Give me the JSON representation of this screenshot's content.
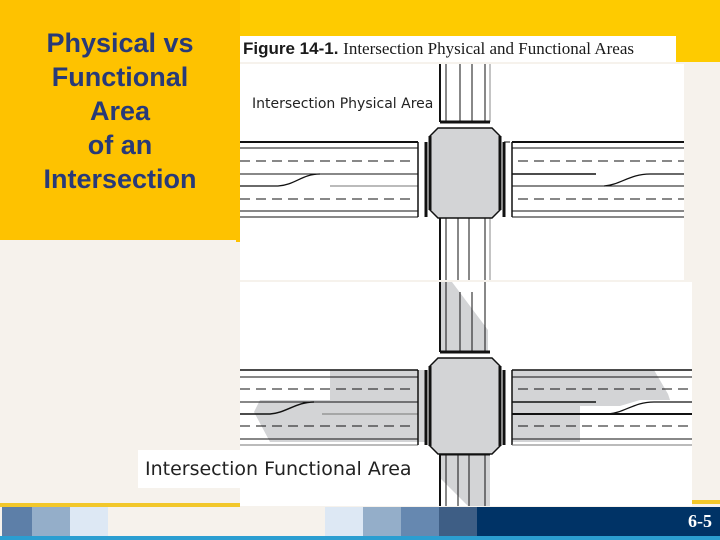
{
  "slide": {
    "title_lines": [
      "Physical vs",
      "Functional",
      "Area",
      "of an",
      "Intersection"
    ],
    "figure_caption_bold": "Figure 14-1.",
    "figure_caption_rest": "Intersection Physical and Functional Areas",
    "physical_diagram_label": "Intersection Physical Area",
    "functional_diagram_label": "Intersection Functional Area",
    "page_number": "6-5"
  },
  "colors": {
    "title_background": "#fec200",
    "title_text": "#283a78",
    "footer_navy": "#003366",
    "accent_line": "#2b9ed1",
    "shading_gray": "#d3d4d6"
  },
  "footer": {
    "left_blocks": [
      "#5d7fa8",
      "#94aec9",
      "#dde8f4"
    ],
    "right_blocks": [
      "#dde8f4",
      "#94aec9",
      "#6688b0",
      "#3e5e85"
    ]
  }
}
